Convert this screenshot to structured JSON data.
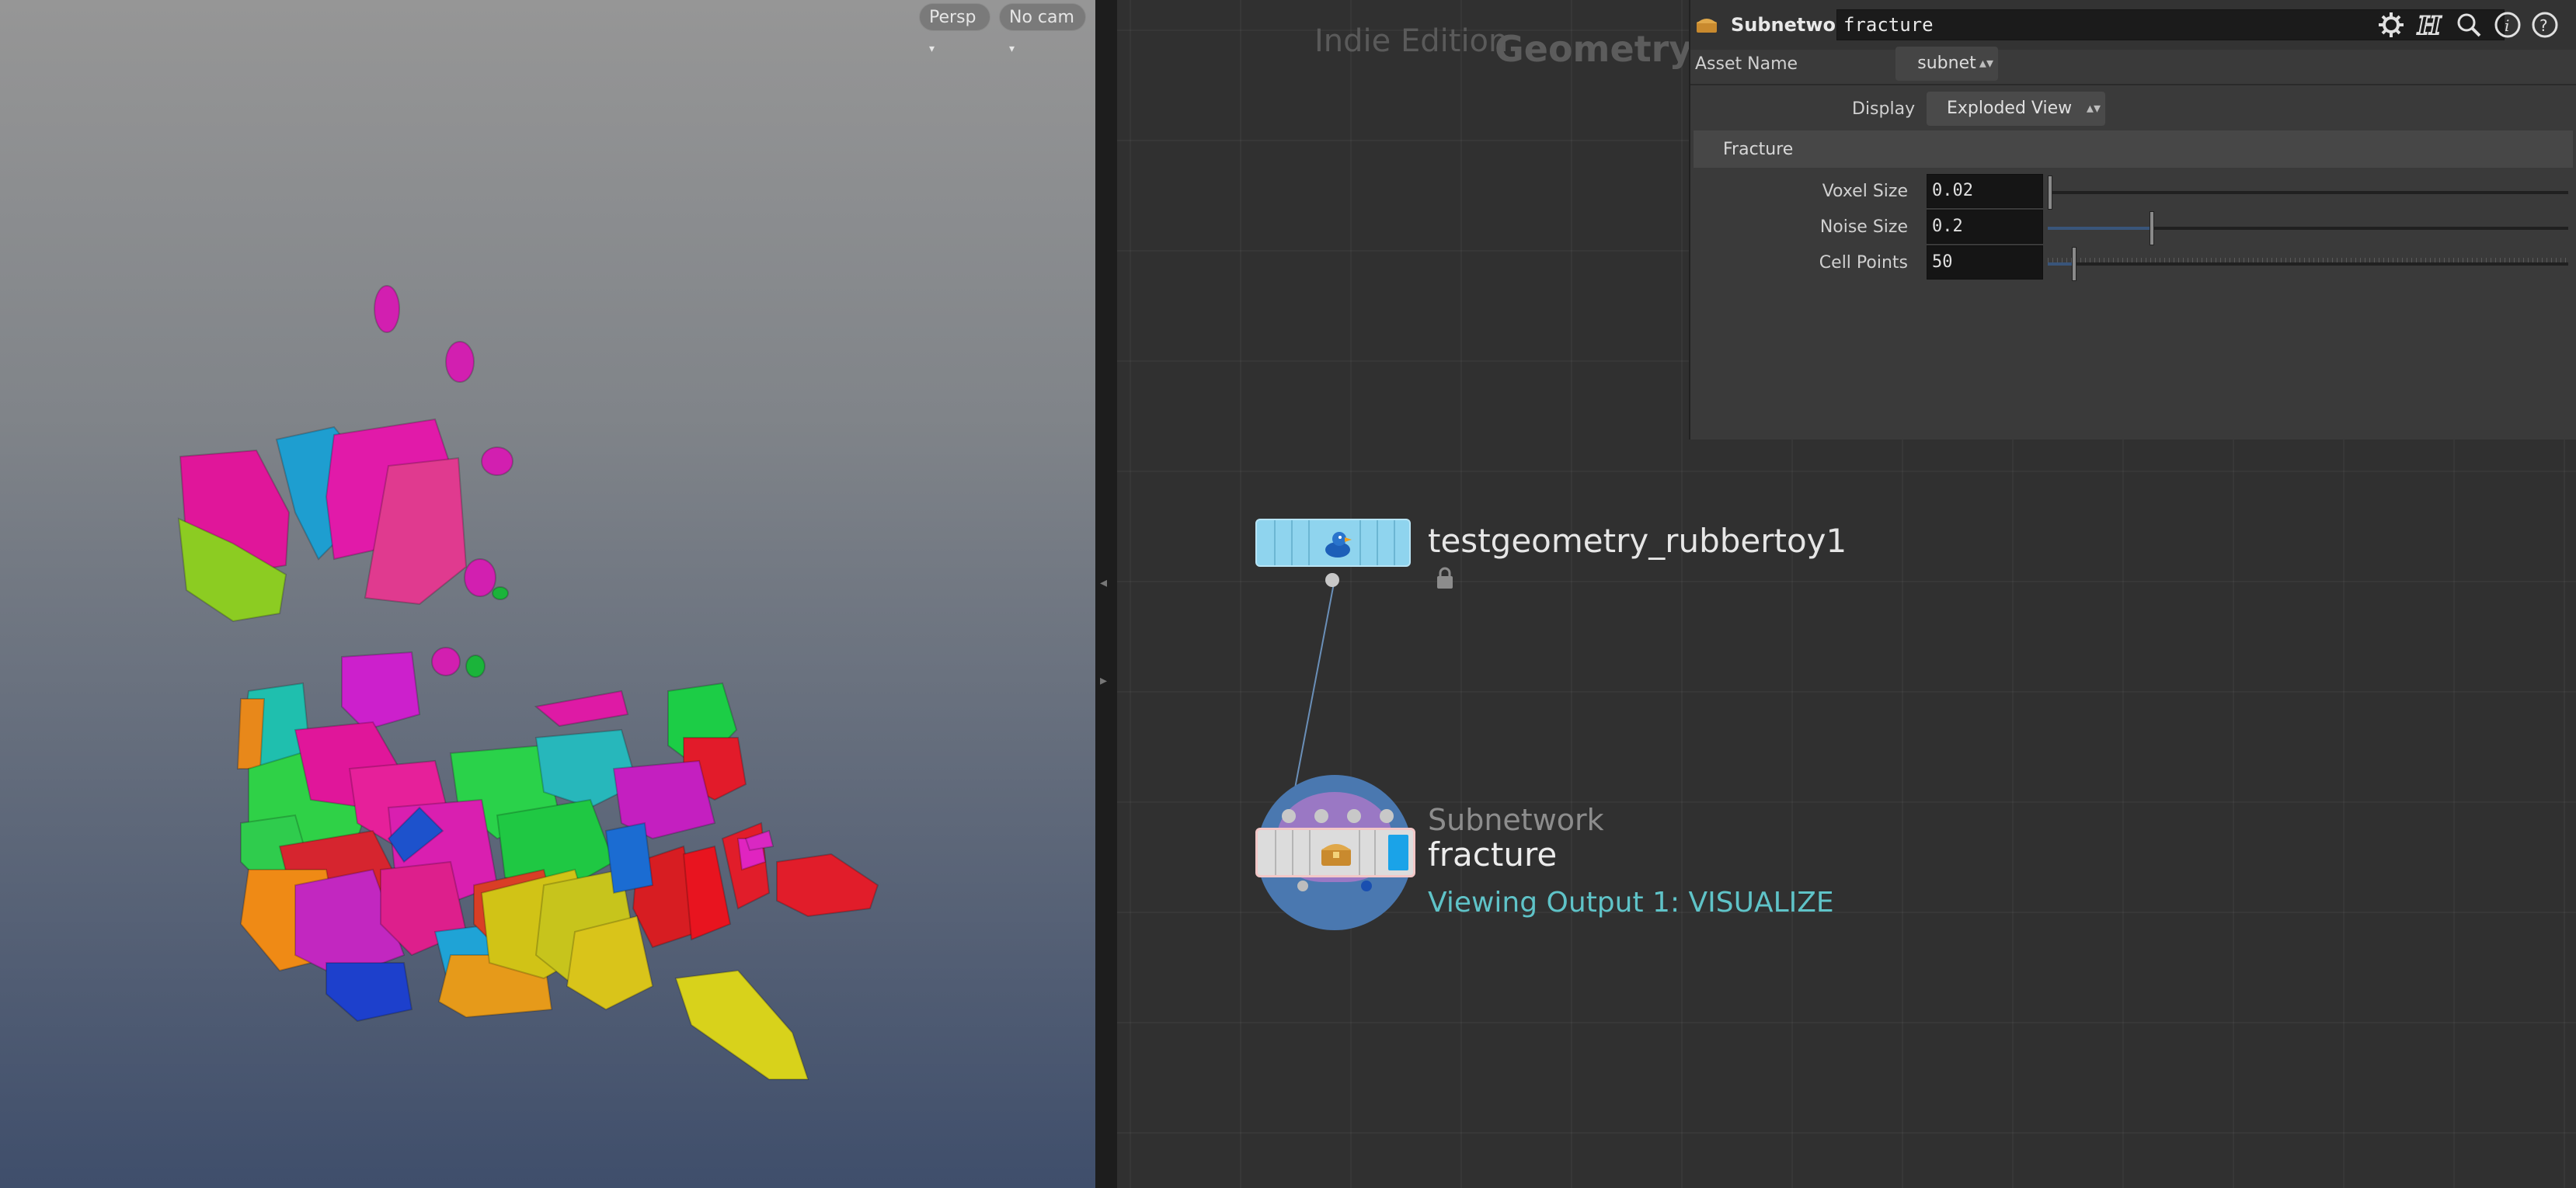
{
  "viewport": {
    "persp_label": "Persp",
    "cam_label": "No cam"
  },
  "network": {
    "edition_label": "Indie Edition",
    "context_label": "Geometry",
    "node_toy": {
      "name": "testgeometry_rubbertoy1",
      "icon": "rubber-duck-icon",
      "color": "#8fd4ee"
    },
    "node_subnet": {
      "type_label": "Subnetwork",
      "name": "fracture",
      "viewing_text": "Viewing Output 1: VISUALIZE",
      "icon": "treasure-chest-icon",
      "color": "#dcdcdc",
      "flag_color": "#1aa3e8"
    }
  },
  "params": {
    "type_label": "Subnetwork",
    "node_name": "fracture",
    "asset_label": "Asset Name",
    "asset_value": "subnet",
    "display_label": "Display",
    "display_value": "Exploded View",
    "folder_label": "Fracture",
    "rows": [
      {
        "label": "Voxel Size",
        "value": "0.02",
        "fraction": 0.0
      },
      {
        "label": "Noise Size",
        "value": "0.2",
        "fraction": 0.2
      },
      {
        "label": "Cell Points",
        "value": "50",
        "fraction": 0.05
      }
    ],
    "header_icons": [
      "gear-icon",
      "houdini-h-icon",
      "search-icon",
      "info-icon",
      "help-icon"
    ]
  }
}
